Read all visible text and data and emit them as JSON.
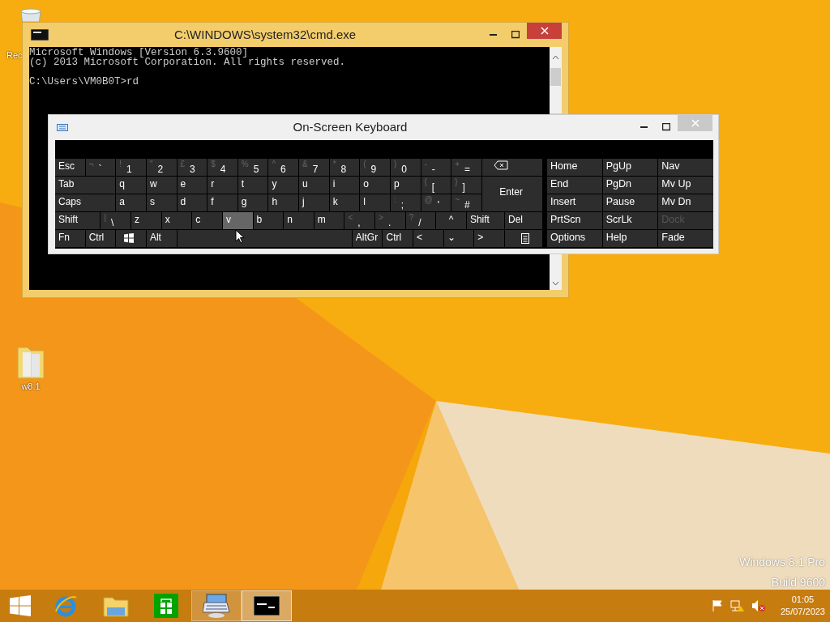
{
  "desktop_icons": [
    {
      "kind": "recycle-bin",
      "label": "Rec"
    },
    {
      "kind": "folder",
      "label": "w8.1"
    }
  ],
  "desktop_watermark": [
    "Windows 8.1 Pro",
    "Build 9600"
  ],
  "cmd_window": {
    "title": "C:\\WINDOWS\\system32\\cmd.exe",
    "lines": [
      "Microsoft Windows [Version 6.3.9600]",
      "(c) 2013 Microsoft Corporation. All rights reserved."
    ],
    "prompt": "C:\\Users\\VM0B0T>rd"
  },
  "osk_window": {
    "title": "On-Screen Keyboard",
    "main_rows": [
      [
        {
          "kind": "text",
          "label": "Esc",
          "hovered": false
        },
        {
          "kind": "text",
          "label": "`",
          "shift": "¬",
          "hovered": false
        },
        {
          "kind": "text",
          "label": "1",
          "shift": "!",
          "hovered": false
        },
        {
          "kind": "text",
          "label": "2",
          "shift": "\"",
          "hovered": false
        },
        {
          "kind": "text",
          "label": "3",
          "shift": "£",
          "hovered": false
        },
        {
          "kind": "text",
          "label": "4",
          "shift": "$",
          "hovered": false
        },
        {
          "kind": "text",
          "label": "5",
          "shift": "%",
          "hovered": false
        },
        {
          "kind": "text",
          "label": "6",
          "shift": "^",
          "hovered": false
        },
        {
          "kind": "text",
          "label": "7",
          "shift": "&",
          "hovered": false
        },
        {
          "kind": "text",
          "label": "8",
          "shift": "*",
          "hovered": false
        },
        {
          "kind": "text",
          "label": "9",
          "shift": "(",
          "hovered": false
        },
        {
          "kind": "text",
          "label": "0",
          "shift": ")",
          "hovered": false
        },
        {
          "kind": "text",
          "label": "-",
          "shift": "-",
          "hovered": false
        },
        {
          "kind": "text",
          "label": "=",
          "shift": "+",
          "hovered": false
        },
        {
          "kind": "backspace",
          "hovered": false
        }
      ],
      [
        {
          "kind": "text",
          "label": "Tab",
          "hovered": false
        },
        {
          "kind": "text",
          "label": "q",
          "hovered": false
        },
        {
          "kind": "text",
          "label": "w",
          "hovered": false
        },
        {
          "kind": "text",
          "label": "e",
          "hovered": false
        },
        {
          "kind": "text",
          "label": "r",
          "hovered": false
        },
        {
          "kind": "text",
          "label": "t",
          "hovered": false
        },
        {
          "kind": "text",
          "label": "y",
          "hovered": false
        },
        {
          "kind": "text",
          "label": "u",
          "hovered": false
        },
        {
          "kind": "text",
          "label": "i",
          "hovered": false
        },
        {
          "kind": "text",
          "label": "o",
          "hovered": false
        },
        {
          "kind": "text",
          "label": "p",
          "hovered": false
        },
        {
          "kind": "text",
          "label": "[",
          "shift": "{",
          "hovered": false
        },
        {
          "kind": "text",
          "label": "]",
          "shift": "}",
          "hovered": false
        },
        {
          "kind": "enter",
          "label": "Enter",
          "hovered": false
        }
      ],
      [
        {
          "kind": "text",
          "label": "Caps",
          "hovered": false
        },
        {
          "kind": "text",
          "label": "a",
          "hovered": false
        },
        {
          "kind": "text",
          "label": "s",
          "hovered": false
        },
        {
          "kind": "text",
          "label": "d",
          "hovered": false
        },
        {
          "kind": "text",
          "label": "f",
          "hovered": false
        },
        {
          "kind": "text",
          "label": "g",
          "hovered": false
        },
        {
          "kind": "text",
          "label": "h",
          "hovered": false
        },
        {
          "kind": "text",
          "label": "j",
          "hovered": false
        },
        {
          "kind": "text",
          "label": "k",
          "hovered": false
        },
        {
          "kind": "text",
          "label": "l",
          "hovered": false
        },
        {
          "kind": "text",
          "label": ";",
          "shift": ":",
          "hovered": false
        },
        {
          "kind": "text",
          "label": "'",
          "shift": "@",
          "hovered": false
        },
        {
          "kind": "text",
          "label": "#",
          "shift": "~",
          "hovered": false
        }
      ],
      [
        {
          "kind": "text",
          "label": "Shift",
          "hovered": false
        },
        {
          "kind": "text",
          "label": "\\",
          "shift": "|",
          "hovered": false
        },
        {
          "kind": "text",
          "label": "z",
          "hovered": false
        },
        {
          "kind": "text",
          "label": "x",
          "hovered": false
        },
        {
          "kind": "text",
          "label": "c",
          "hovered": false
        },
        {
          "kind": "text",
          "label": "v",
          "hovered": true
        },
        {
          "kind": "text",
          "label": "b",
          "hovered": false
        },
        {
          "kind": "text",
          "label": "n",
          "hovered": false
        },
        {
          "kind": "text",
          "label": "m",
          "hovered": false
        },
        {
          "kind": "text",
          "label": ",",
          "shift": "<",
          "hovered": false
        },
        {
          "kind": "text",
          "label": ".",
          "shift": ">",
          "hovered": false
        },
        {
          "kind": "text",
          "label": "/",
          "shift": "?",
          "hovered": false
        },
        {
          "kind": "text",
          "label": "^",
          "hovered": false
        },
        {
          "kind": "text",
          "label": "Shift",
          "hovered": false
        },
        {
          "kind": "text",
          "label": "Del",
          "hovered": false
        }
      ],
      [
        {
          "kind": "text",
          "label": "Fn",
          "hovered": false
        },
        {
          "kind": "text",
          "label": "Ctrl",
          "hovered": false
        },
        {
          "kind": "windows",
          "hovered": false
        },
        {
          "kind": "text",
          "label": "Alt",
          "hovered": false
        },
        {
          "kind": "space",
          "hovered": false
        },
        {
          "kind": "text",
          "label": "AltGr",
          "hovered": false
        },
        {
          "kind": "text",
          "label": "Ctrl",
          "hovered": false
        },
        {
          "kind": "text",
          "label": "<",
          "hovered": false
        },
        {
          "kind": "text",
          "label": "⌄",
          "hovered": false
        },
        {
          "kind": "text",
          "label": ">",
          "hovered": false
        },
        {
          "kind": "menu",
          "hovered": false
        }
      ]
    ],
    "nav_keys": [
      {
        "label": "Home",
        "disabled": false
      },
      {
        "label": "PgUp",
        "disabled": false
      },
      {
        "label": "Nav",
        "disabled": false
      },
      {
        "label": "End",
        "disabled": false
      },
      {
        "label": "PgDn",
        "disabled": false
      },
      {
        "label": "Mv Up",
        "disabled": false
      },
      {
        "label": "Insert",
        "disabled": false
      },
      {
        "label": "Pause",
        "disabled": false
      },
      {
        "label": "Mv Dn",
        "disabled": false
      },
      {
        "label": "PrtScn",
        "disabled": false
      },
      {
        "label": "ScrLk",
        "disabled": false
      },
      {
        "label": "Dock",
        "disabled": true
      },
      {
        "label": "Options",
        "disabled": false
      },
      {
        "label": "Help",
        "disabled": false
      },
      {
        "label": "Fade",
        "disabled": false
      }
    ]
  },
  "taskbar": {
    "items": [
      {
        "kind": "start",
        "running": false,
        "selected": false
      },
      {
        "kind": "browser",
        "running": false,
        "selected": false
      },
      {
        "kind": "explorer",
        "running": false,
        "selected": false
      },
      {
        "kind": "store",
        "running": false,
        "selected": false
      },
      {
        "kind": "keyboard",
        "running": true,
        "selected": false
      },
      {
        "kind": "console",
        "running": true,
        "selected": true
      }
    ],
    "tray": [
      {
        "kind": "flag"
      },
      {
        "kind": "network"
      },
      {
        "kind": "volume-muted"
      }
    ],
    "time": "01:05",
    "date": "25/07/2023"
  }
}
